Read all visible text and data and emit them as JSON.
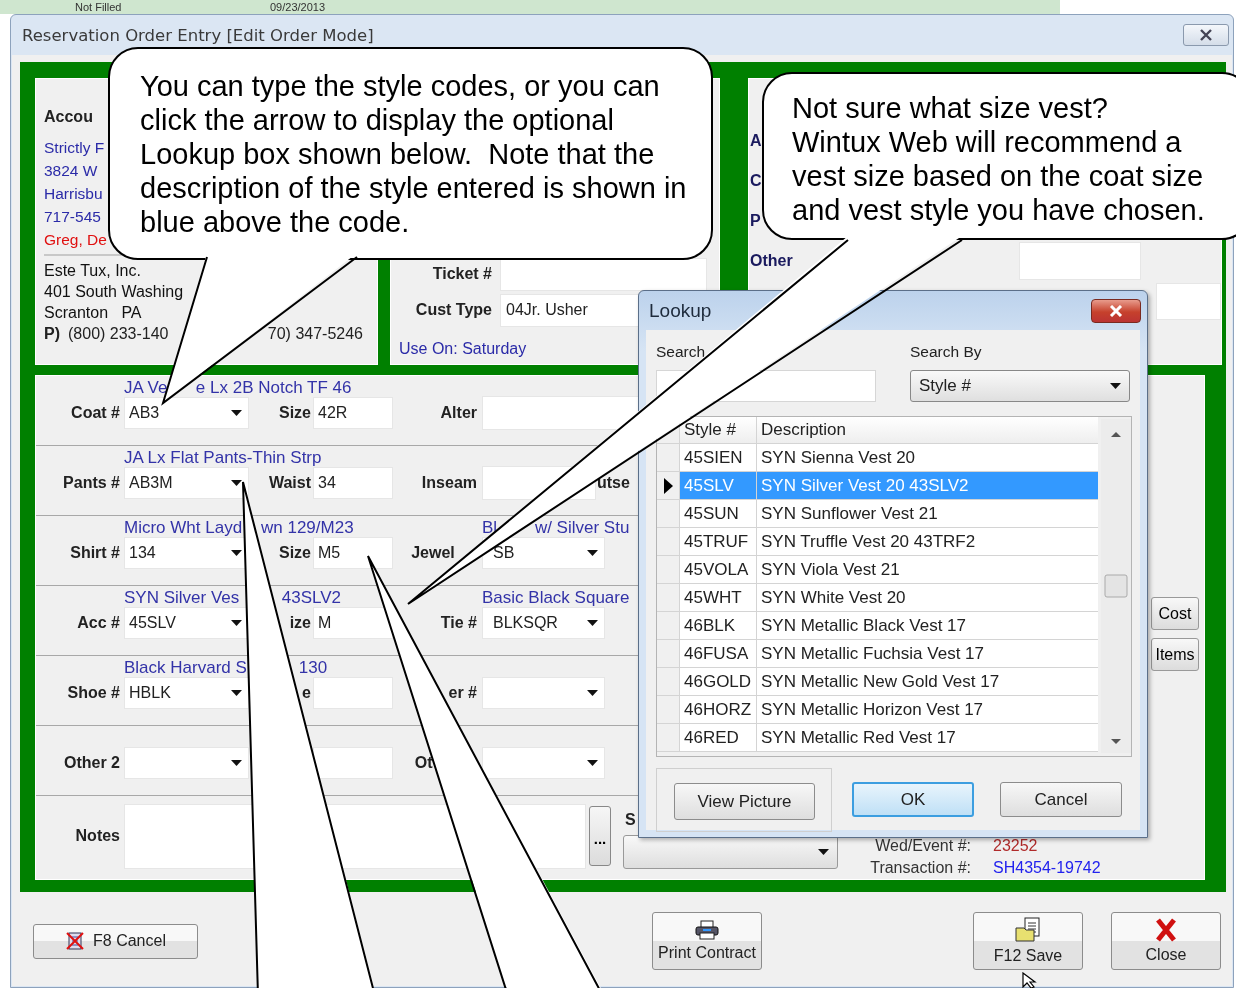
{
  "background_row": {
    "status": "Not Filled",
    "date": "09/23/2013"
  },
  "window": {
    "title": "Reservation Order Entry [Edit Order Mode]"
  },
  "account": {
    "heading": "Accou",
    "lines": [
      "Strictly F",
      "3824 W",
      "Harrisbu",
      "717-545"
    ],
    "contact": "Greg, De",
    "store": [
      "Este Tux, Inc.",
      "401 South Washing",
      "Scranton   PA"
    ],
    "phone_label": "P)",
    "phone": "(800) 233-140",
    "fax": "70) 347-5246"
  },
  "order": {
    "ticket_label": "Ticket #",
    "cust_type_label": "Cust Type",
    "cust_type": "04Jr. Usher",
    "use_on": "Use On: Saturday"
  },
  "side_panel": {
    "labels": [
      "A",
      "C",
      "P"
    ],
    "other_label": "Other"
  },
  "items": [
    {
      "kind": "item",
      "label": "Coat #",
      "description": "JA Ve      e Lx 2B Notch TF 46",
      "value": "AB3",
      "size_label": "Size",
      "size": "42R",
      "extra": {
        "kind": "field",
        "label": "Alter"
      }
    },
    {
      "kind": "item",
      "label": "Pants #",
      "description": "JA Lx Flat Pants-Thin Strp",
      "value": "AB3M",
      "size_label": "Waist",
      "size": "34",
      "extra": {
        "kind": "field",
        "label": "Inseam",
        "tail_label": "utse"
      }
    },
    {
      "kind": "item",
      "label": "Shirt #",
      "description": "Micro Wht Layd    wn 129/M23",
      "value": "134",
      "size_label": "Size",
      "size": "M5",
      "extra": {
        "kind": "combo",
        "label": "Jewel     ",
        "value": "SB",
        "description": "Bl        w/ Silver Stu"
      }
    },
    {
      "kind": "item",
      "label": "Acc #",
      "description": "SYN Silver Ves         43SLV2",
      "value": "45SLV",
      "size_label": "ize",
      "size": "M",
      "extra": {
        "kind": "combo",
        "label": "Tie #",
        "value": "BLKSQR",
        "description": "Basic Black Square"
      }
    },
    {
      "kind": "item",
      "label": "Shoe #",
      "description": "Black Harvard S           130",
      "value": "HBLK",
      "size_label": "e",
      "extra": {
        "kind": "combo",
        "label": "er #"
      }
    },
    {
      "kind": "item",
      "label": "Other 2",
      "extra": {
        "kind": "combo",
        "label": "Ot          "
      }
    },
    {
      "kind": "notes",
      "label": "Notes",
      "more_button": "...",
      "status_label": "S"
    }
  ],
  "side_buttons": [
    "Cost",
    "Items"
  ],
  "info": [
    {
      "label": "Wed/Event #:",
      "value": "23252",
      "color": "#b02a2a"
    },
    {
      "label": "Transaction #:",
      "value": "SH4354-19742",
      "color": "#2222ee"
    }
  ],
  "footer_buttons": [
    {
      "kind": "cancel",
      "label": "F8 Cancel"
    },
    {
      "kind": "print",
      "label": "Print Contract"
    },
    {
      "kind": "save",
      "label": "F12 Save"
    },
    {
      "kind": "close",
      "label": "Close"
    }
  ],
  "lookup": {
    "title": "Lookup",
    "search_label": "Search",
    "search_by_label": "Search By",
    "search_by": "Style #",
    "columns": [
      "Style #",
      "Description"
    ],
    "rows": [
      {
        "style": "45SIEN",
        "description": "SYN Sienna Vest 20",
        "selected": false
      },
      {
        "style": "45SLV",
        "description": "SYN Silver Vest 20 43SLV2",
        "selected": true
      },
      {
        "style": "45SUN",
        "description": "SYN Sunflower Vest 21",
        "selected": false
      },
      {
        "style": "45TRUF",
        "description": "SYN Truffle Vest 20 43TRF2",
        "selected": false
      },
      {
        "style": "45VOLA",
        "description": "SYN Viola Vest 21",
        "selected": false
      },
      {
        "style": "45WHT",
        "description": "SYN White Vest 20",
        "selected": false
      },
      {
        "style": "46BLK",
        "description": "SYN Metallic Black Vest 17",
        "selected": false
      },
      {
        "style": "46FUSA",
        "description": "SYN Metallic Fuchsia Vest 17",
        "selected": false
      },
      {
        "style": "46GOLD",
        "description": "SYN Metallic New Gold Vest 17",
        "selected": false
      },
      {
        "style": "46HORZ",
        "description": "SYN Metallic Horizon Vest 17",
        "selected": false
      },
      {
        "style": "46RED",
        "description": "SYN Metallic Red Vest 17",
        "selected": false
      }
    ],
    "buttons": [
      {
        "label": "View Picture",
        "default": false
      },
      {
        "label": "OK",
        "default": true
      },
      {
        "label": "Cancel",
        "default": false
      }
    ]
  },
  "callouts": [
    {
      "paragraphs": [
        "You can type the style codes, or you can click the arrow to display the optional Lookup box shown below.  Note that the description of the style entered is shown in blue above the code."
      ]
    },
    {
      "paragraphs": [
        "Not sure what size vest?",
        "Wintux Web will recommend a vest size based on the coat size and vest style you have chosen."
      ]
    }
  ]
}
